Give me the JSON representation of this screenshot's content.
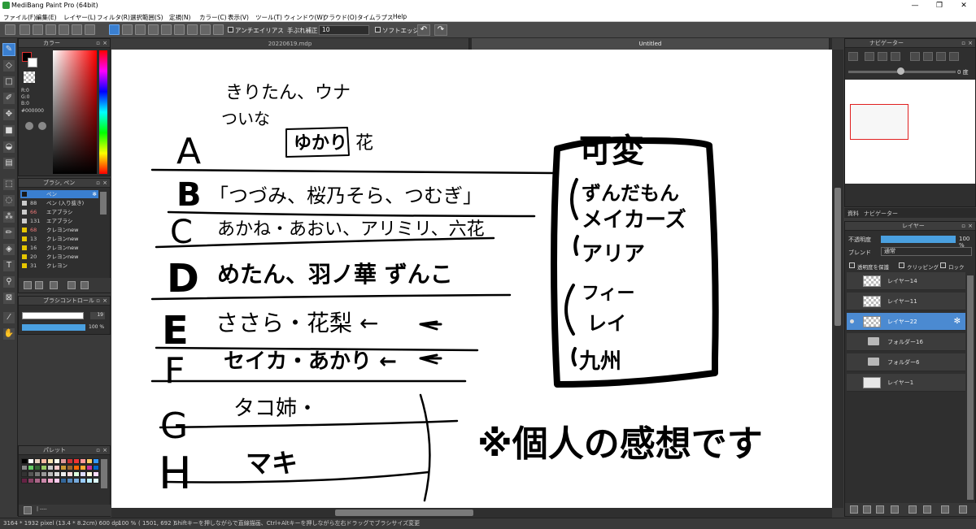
{
  "window": {
    "title": "MediBang Paint Pro (64bit)",
    "min": "—",
    "max": "❐",
    "close": "✕"
  },
  "menu": [
    "ファイル(F)",
    "編集(E)",
    "レイヤー(L)",
    "フィルタ(R)",
    "選択範囲(S)",
    "定規(N)",
    "カラー(C)",
    "表示(V)",
    "ツール(T)",
    "ウィンドウ(W)",
    "クラウド(O)",
    "タイムラプス",
    "Help"
  ],
  "toolbar": {
    "antialias": "アンチエイリアス",
    "stabilizer": "手ぶれ補正",
    "stabilizer_value": "10",
    "soft_edge": "ソフトエッジ",
    "undo": "↶",
    "redo": "↷"
  },
  "tabs": [
    "20220619.mdp",
    "Untitled"
  ],
  "color_panel": {
    "title": "カラー",
    "r": "R:0",
    "g": "G:0",
    "b": "B:0",
    "hex": "#000000"
  },
  "brush_panel": {
    "title": "ブラシ, ペン",
    "items": [
      {
        "num": "",
        "name": "ペン",
        "color": "#1a1a1a",
        "selected": true
      },
      {
        "num": "88",
        "name": "ペン (入り抜き)",
        "color": "#cccccc",
        "selected": false
      },
      {
        "num": "66",
        "name": "エアブラシ",
        "color": "#cccccc",
        "selected": false
      },
      {
        "num": "131",
        "name": "エアブラシ",
        "color": "#cccccc",
        "selected": false
      },
      {
        "num": "68",
        "name": "クレヨンnew",
        "color": "#e6c600",
        "selected": false
      },
      {
        "num": "13",
        "name": "クレヨンnew",
        "color": "#e6c600",
        "selected": false
      },
      {
        "num": "16",
        "name": "クレヨンnew",
        "color": "#e6c600",
        "selected": false
      },
      {
        "num": "20",
        "name": "クレヨンnew",
        "color": "#e6c600",
        "selected": false
      },
      {
        "num": "31",
        "name": "クレヨン",
        "color": "#e6c600",
        "selected": false
      }
    ]
  },
  "brush_control": {
    "title": "ブラシコントロール",
    "size": "19",
    "opacity": "100 %"
  },
  "palette": {
    "title": "パレット",
    "menu": "| ----"
  },
  "navigator": {
    "title": "ナビゲーター",
    "angle": "0 度"
  },
  "side_tabs": [
    "資料",
    "ナビゲーター"
  ],
  "layer_panel": {
    "title": "レイヤー",
    "opacity_label": "不透明度",
    "opacity_value": "100 %",
    "blend_label": "ブレンド",
    "blend_value": "通常",
    "opt_protect": "透明度を保護",
    "opt_clip": "クリッピング",
    "opt_lock": "ロック",
    "layers": [
      {
        "name": "レイヤー14",
        "type": "layer",
        "selected": false
      },
      {
        "name": "レイヤー11",
        "type": "layer",
        "selected": false
      },
      {
        "name": "レイヤー22",
        "type": "layer",
        "selected": true
      },
      {
        "name": "フォルダー16",
        "type": "folder",
        "selected": false
      },
      {
        "name": "フォルダー6",
        "type": "folder",
        "selected": false
      },
      {
        "name": "レイヤー1",
        "type": "layer",
        "selected": false
      }
    ]
  },
  "status": {
    "size": "3164 * 1932 pixel (13.4 * 8.2cm) 600 dpi",
    "zoom": "100 %",
    "coords": "( 1501, 692 )",
    "hint": "Shiftキーを押しながらで直線描画、Ctrl+Altキーを押しながら左右ドラッグでブラシサイズ変更"
  },
  "drawing": {
    "top_names": "きりたん、ウナ",
    "tsuina": "ついな",
    "yukari": "ゆかり",
    "hana": "花",
    "rows": [
      {
        "letter": "A",
        "text": ""
      },
      {
        "letter": "B",
        "text": "「つづみ、桜乃そら、つむぎ」"
      },
      {
        "letter": "C",
        "text": "あかね・あおい、アリミリ、六花"
      },
      {
        "letter": "D",
        "text": "めたん、羽ノ華 ずんこ"
      },
      {
        "letter": "E",
        "text": "ささら・花梨 ←"
      },
      {
        "letter": "F",
        "text": "セイカ・あかり ←"
      },
      {
        "letter": "G",
        "text": "タコ姉・"
      },
      {
        "letter": "H",
        "text": "マキ"
      }
    ],
    "box_title": "可変",
    "box_items": [
      "ずんだもん",
      "メイカーズ",
      "アリア",
      "フィー",
      "レイ",
      "九州"
    ],
    "note": "※個人の感想です"
  }
}
